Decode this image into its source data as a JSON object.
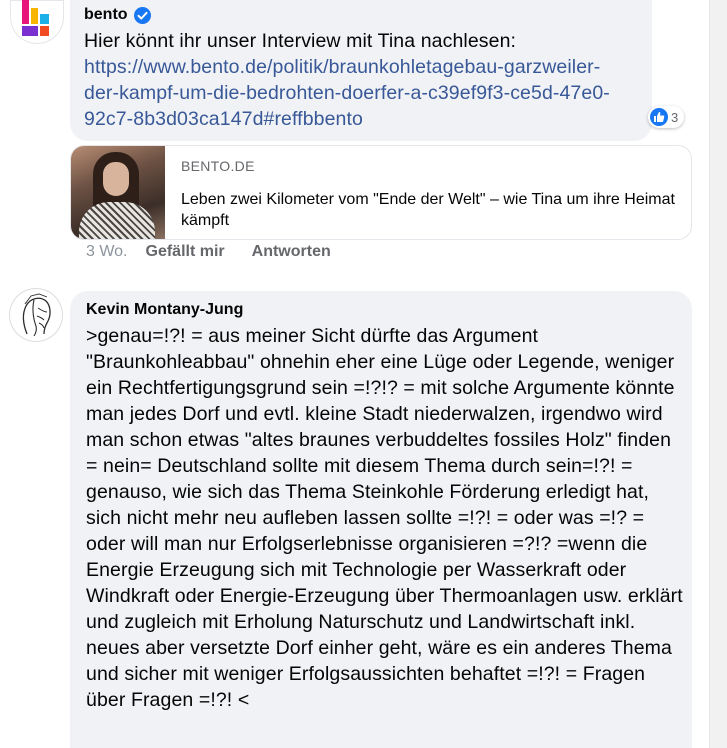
{
  "comment1": {
    "author": "bento",
    "verified": true,
    "text_prefix": "Hier könnt ihr unser Interview mit Tina nachlesen: ",
    "link_text": "https://www.bento.de/politik/braunkohletagebau-garzweiler-der-kampf-um-die-bedrohten-doerfer-a-c39ef9f3-ce5d-47e0-92c7-8b3d03ca147d#reffbbento",
    "reaction_count": "3",
    "preview": {
      "domain": "BENTO.DE",
      "title": "Leben zwei Kilometer vom \"Ende der Welt\" – wie Tina um ihre Heimat kämpft"
    },
    "actions": {
      "time": "3 Wo.",
      "like": "Gefällt mir",
      "reply": "Antworten"
    }
  },
  "comment2": {
    "author": "Kevin Montany-Jung",
    "text": ">genau=!?! = aus meiner Sicht dürfte das Argument \"Braunkohleabbau\" ohnehin eher eine Lüge oder Legende, weniger ein Rechtfertigungsgrund sein =!?!? = mit solche Argumente könnte man jedes Dorf und evtl. kleine Stadt niederwalzen, irgendwo wird man schon etwas  \"altes braunes verbuddeltes fossiles Holz\" finden = nein= Deutschland sollte mit diesem Thema durch sein=!?! = genauso, wie sich das Thema Steinkohle Förderung erledigt hat, sich nicht mehr neu aufleben lassen sollte =!?! = oder was =!? = oder will man nur Erfolgserlebnisse organisieren =?!? =wenn die Energie Erzeugung sich mit Technologie per Wasserkraft oder Windkraft oder Energie-Erzeugung über Thermoanlagen usw. erklärt und zugleich mit Erholung Naturschutz und Landwirtschaft inkl. neues aber versetzte Dorf einher geht, wäre es ein anderes Thema und sicher mit weniger Erfolgsaussichten behaftet =!?! = Fragen über Fragen =!?! <"
  },
  "colors": {
    "bubble": "#f0f2f5",
    "link": "#385898",
    "brand_blue": "#1877f2",
    "meta_gray": "#65676b"
  },
  "icons": {
    "verified": "verified-badge-icon",
    "like": "like-thumb-icon",
    "bento_logo": "bento-logo-icon"
  }
}
